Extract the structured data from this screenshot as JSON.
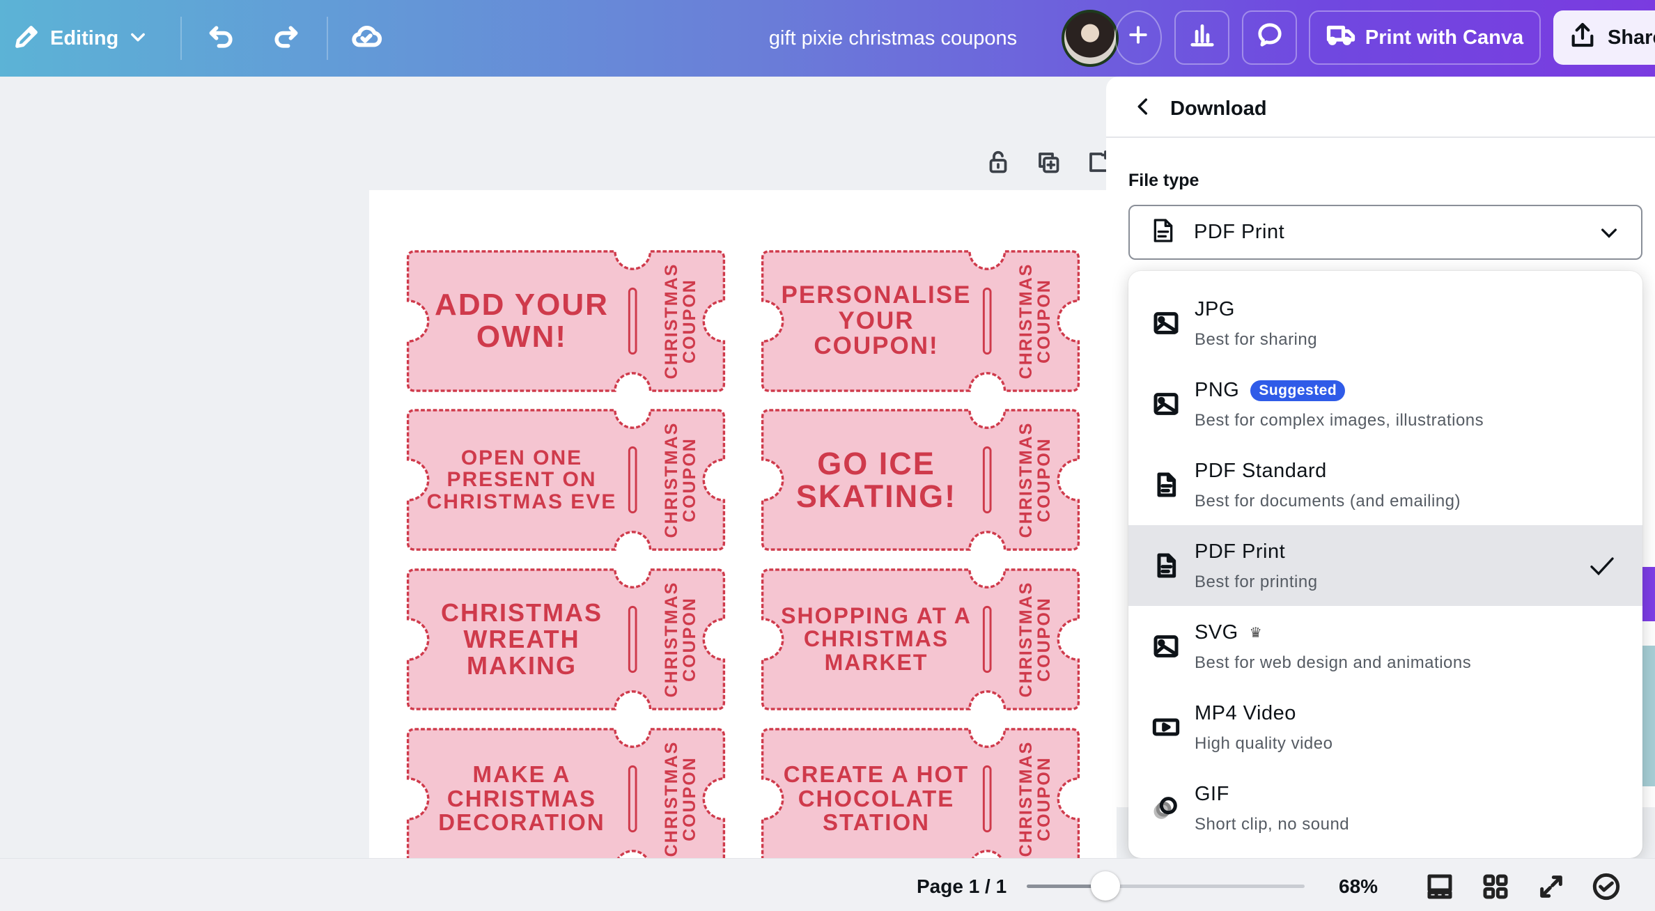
{
  "topbar": {
    "editing_label": "Editing",
    "title": "gift pixie christmas coupons",
    "print_label": "Print with Canva",
    "share_label": "Share"
  },
  "canvas": {
    "coupon_side_label_line1": "CHRISTMAS",
    "coupon_side_label_line2": "COUPON",
    "coupons": [
      {
        "text": "ADD YOUR OWN!"
      },
      {
        "text": "PERSONALISE YOUR COUPON!"
      },
      {
        "text": "OPEN ONE PRESENT ON CHRISTMAS EVE"
      },
      {
        "text": "GO ICE SKATING!"
      },
      {
        "text": "CHRISTMAS WREATH MAKING"
      },
      {
        "text": "SHOPPING AT A CHRISTMAS MARKET"
      },
      {
        "text": "MAKE A CHRISTMAS DECORATION"
      },
      {
        "text": "CREATE A HOT CHOCOLATE STATION"
      }
    ],
    "colors": {
      "fill": "#f5c5d1",
      "stroke": "#cf3a4b"
    }
  },
  "download_panel": {
    "title": "Download",
    "file_type_label": "File type",
    "selected": "PDF Print",
    "options": [
      {
        "title": "JPG",
        "subtitle": "Best for sharing",
        "icon": "image-icon"
      },
      {
        "title": "PNG",
        "subtitle": "Best for complex images, illustrations",
        "icon": "image-icon",
        "badge": "Suggested"
      },
      {
        "title": "PDF Standard",
        "subtitle": "Best for documents (and emailing)",
        "icon": "document-icon"
      },
      {
        "title": "PDF Print",
        "subtitle": "Best for printing",
        "icon": "document-icon",
        "selected": true
      },
      {
        "title": "SVG",
        "subtitle": "Best for web design and animations",
        "icon": "image-icon",
        "premium": true
      },
      {
        "title": "MP4 Video",
        "subtitle": "High quality video",
        "icon": "video-icon"
      },
      {
        "title": "GIF",
        "subtitle": "Short clip, no sound",
        "icon": "gif-icon"
      }
    ]
  },
  "bottombar": {
    "page_label": "Page 1 / 1",
    "zoom_label": "68%",
    "zoom_percent": 68
  }
}
